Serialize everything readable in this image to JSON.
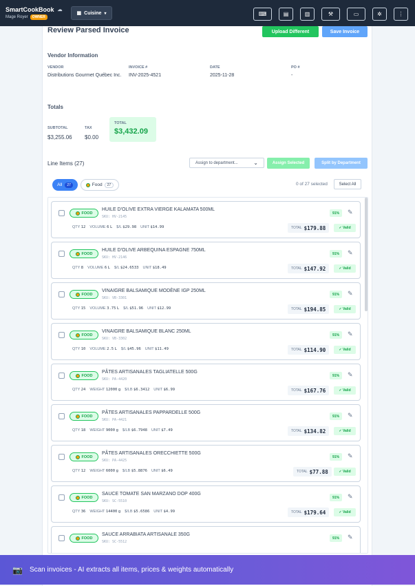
{
  "app": {
    "name": "SmartCookBook",
    "user": "Mage Royer",
    "role": "OWNER",
    "department": "Cuisine"
  },
  "page": {
    "title": "Review Parsed Invoice",
    "upload_label": "Upload Different",
    "save_label": "Save Invoice"
  },
  "vendor": {
    "section_label": "Vendor Information",
    "fields": [
      {
        "label": "VENDOR",
        "value": "Distributions Gourmet Québec Inc."
      },
      {
        "label": "INVOICE #",
        "value": "INV-2025-4521"
      },
      {
        "label": "DATE",
        "value": "2025-11-28"
      },
      {
        "label": "PO #",
        "value": "-"
      }
    ]
  },
  "totals": {
    "section_label": "Totals",
    "subtotal_label": "SUBTOTAL",
    "subtotal": "$3,255.06",
    "tax_label": "TAX",
    "tax": "$0.00",
    "total_label": "TOTAL",
    "total": "$3,432.09"
  },
  "line_items": {
    "heading": "Line Items (27)",
    "assign_placeholder": "Assign to department...",
    "assign_selected_label": "Assign Selected",
    "split_label": "Split by Department",
    "filter_all_label": "All",
    "filter_all_count": "27",
    "filter_food_label": "Food",
    "filter_food_count": "27",
    "selected_text": "0 of 27 selected",
    "select_all_label": "Select All",
    "items": [
      {
        "badge": "FOOD",
        "name": "HUILE D'OLIVE EXTRA VIERGE KALAMATA 500ML",
        "sku": "SKU: HV-2145",
        "qty_label": "QTY",
        "qty": "12",
        "measure_label": "VOLUME",
        "measure": "6",
        "unit": "L",
        "rate_label": "$/L",
        "rate": "$29.98",
        "unit_label": "UNIT",
        "unit_price": "$14.99",
        "total_label": "TOTAL",
        "total": "$179.88",
        "confidence": "91%",
        "status": "Valid"
      },
      {
        "badge": "FOOD",
        "name": "HUILE D'OLIVE ARBEQUINA ESPAGNE 750ML",
        "sku": "SKU: HV-2146",
        "qty_label": "QTY",
        "qty": "8",
        "measure_label": "VOLUME",
        "measure": "6",
        "unit": "L",
        "rate_label": "$/L",
        "rate": "$24.6533",
        "unit_label": "UNIT",
        "unit_price": "$18.49",
        "total_label": "TOTAL",
        "total": "$147.92",
        "confidence": "91%",
        "status": "Valid"
      },
      {
        "badge": "FOOD",
        "name": "VINAIGRE BALSAMIQUE MODÈNE IGP 250ML",
        "sku": "SKU: VB-3301",
        "qty_label": "QTY",
        "qty": "15",
        "measure_label": "VOLUME",
        "measure": "3.75",
        "unit": "L",
        "rate_label": "$/L",
        "rate": "$51.96",
        "unit_label": "UNIT",
        "unit_price": "$12.99",
        "total_label": "TOTAL",
        "total": "$194.85",
        "confidence": "91%",
        "status": "Valid"
      },
      {
        "badge": "FOOD",
        "name": "VINAIGRE BALSAMIQUE BLANC 250ML",
        "sku": "SKU: VB-3302",
        "qty_label": "QTY",
        "qty": "10",
        "measure_label": "VOLUME",
        "measure": "2.5",
        "unit": "L",
        "rate_label": "$/L",
        "rate": "$45.96",
        "unit_label": "UNIT",
        "unit_price": "$11.49",
        "total_label": "TOTAL",
        "total": "$114.90",
        "confidence": "91%",
        "status": "Valid"
      },
      {
        "badge": "FOOD",
        "name": "PÂTES ARTISANALES TAGLIATELLE 500G",
        "sku": "SKU: PA-4420",
        "qty_label": "QTY",
        "qty": "24",
        "measure_label": "WEIGHT",
        "measure": "12000",
        "unit": "g",
        "rate_label": "$/LB",
        "rate": "$6.3412",
        "unit_label": "UNIT",
        "unit_price": "$6.99",
        "total_label": "TOTAL",
        "total": "$167.76",
        "confidence": "91%",
        "status": "Valid"
      },
      {
        "badge": "FOOD",
        "name": "PÂTES ARTISANALES PAPPARDELLE 500G",
        "sku": "SKU: PA-4421",
        "qty_label": "QTY",
        "qty": "18",
        "measure_label": "WEIGHT",
        "measure": "9000",
        "unit": "g",
        "rate_label": "$/LB",
        "rate": "$6.7948",
        "unit_label": "UNIT",
        "unit_price": "$7.49",
        "total_label": "TOTAL",
        "total": "$134.82",
        "confidence": "91%",
        "status": "Valid"
      },
      {
        "badge": "FOOD",
        "name": "PÂTES ARTISANALES ORECCHIETTE 500G",
        "sku": "SKU: PA-4425",
        "qty_label": "QTY",
        "qty": "12",
        "measure_label": "WEIGHT",
        "measure": "6000",
        "unit": "g",
        "rate_label": "$/LB",
        "rate": "$5.8876",
        "unit_label": "UNIT",
        "unit_price": "$6.49",
        "total_label": "TOTAL",
        "total": "$77.88",
        "confidence": "91%",
        "status": "Valid"
      },
      {
        "badge": "FOOD",
        "name": "SAUCE TOMATE SAN MARZANO DOP 400G",
        "sku": "SKU: SC-5510",
        "qty_label": "QTY",
        "qty": "36",
        "measure_label": "WEIGHT",
        "measure": "14400",
        "unit": "g",
        "rate_label": "$/LB",
        "rate": "$5.6586",
        "unit_label": "UNIT",
        "unit_price": "$4.99",
        "total_label": "TOTAL",
        "total": "$179.64",
        "confidence": "91%",
        "status": "Valid"
      },
      {
        "badge": "FOOD",
        "name": "SAUCE ARRABIATA ARTISANALE 350G",
        "sku": "SKU: SC-5512",
        "confidence": "91%"
      }
    ]
  },
  "footer": {
    "text": "Scan invoices - AI extracts all items, prices & weights automatically"
  }
}
